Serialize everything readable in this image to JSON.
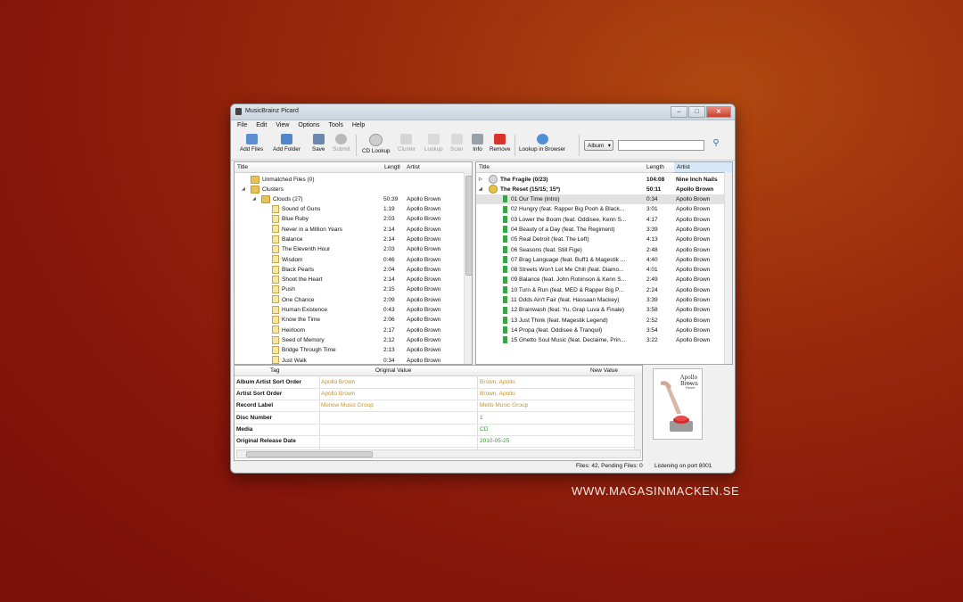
{
  "window": {
    "title": "MusicBrainz Picard"
  },
  "menu": [
    "File",
    "Edit",
    "View",
    "Options",
    "Tools",
    "Help"
  ],
  "toolbar": {
    "add_files": "Add Files",
    "add_folder": "Add Folder",
    "save": "Save",
    "submit": "Submit",
    "cd_lookup": "CD Lookup",
    "cluster": "Cluster",
    "lookup": "Lookup",
    "scan": "Scan",
    "info": "Info",
    "remove": "Remove",
    "lookup_browser": "Lookup in Browser",
    "album_select": "Album"
  },
  "left_panel": {
    "headers": {
      "title": "Title",
      "length": "Lengtl",
      "artist": "Artist"
    },
    "unmatched": "Unmatched Files (0)",
    "clusters": "Clusters",
    "cluster": {
      "title": "Clouds (27)",
      "length": "50:39",
      "artist": "Apollo Brown"
    },
    "files": [
      {
        "title": "Sound of Guns",
        "length": "1:19",
        "artist": "Apollo Brown"
      },
      {
        "title": "Blue Ruby",
        "length": "2:03",
        "artist": "Apollo Brown"
      },
      {
        "title": "Never in a Million Years",
        "length": "2:14",
        "artist": "Apollo Brown"
      },
      {
        "title": "Balance",
        "length": "2:14",
        "artist": "Apollo Brown"
      },
      {
        "title": "The Eleventh Hour",
        "length": "2:03",
        "artist": "Apollo Brown"
      },
      {
        "title": "Wisdom",
        "length": "0:46",
        "artist": "Apollo Brown"
      },
      {
        "title": "Black Pearls",
        "length": "2:04",
        "artist": "Apollo Brown"
      },
      {
        "title": "Shoot the Heart",
        "length": "2:14",
        "artist": "Apollo Brown"
      },
      {
        "title": "Push",
        "length": "2:15",
        "artist": "Apollo Brown"
      },
      {
        "title": "One Chance",
        "length": "2:09",
        "artist": "Apollo Brown"
      },
      {
        "title": "Human Existence",
        "length": "0:43",
        "artist": "Apollo Brown"
      },
      {
        "title": "Know the Time",
        "length": "2:06",
        "artist": "Apollo Brown"
      },
      {
        "title": "Heirloom",
        "length": "2:17",
        "artist": "Apollo Brown"
      },
      {
        "title": "Seed of Memory",
        "length": "2:12",
        "artist": "Apollo Brown"
      },
      {
        "title": "Bridge Through Time",
        "length": "2:13",
        "artist": "Apollo Brown"
      },
      {
        "title": "Just Walk",
        "length": "0:34",
        "artist": "Apollo Brown"
      }
    ]
  },
  "right_panel": {
    "headers": {
      "title": "Title",
      "length": "Length",
      "artist": "Artist"
    },
    "albums": [
      {
        "title": "The Fragile (0/23)",
        "length": "104:08",
        "artist": "Nine Inch Nails"
      },
      {
        "title": "The Reset (15/15; 15*)",
        "length": "50:11",
        "artist": "Apollo Brown"
      }
    ],
    "tracks": [
      {
        "title": "01  Our Time (intro)",
        "length": "0:34",
        "artist": "Apollo Brown"
      },
      {
        "title": "02  Hungry (feat. Rapper Big Pooh & Black...",
        "length": "3:01",
        "artist": "Apollo Brown"
      },
      {
        "title": "03  Lower the Boom (feat. Oddisee, Kenn S...",
        "length": "4:17",
        "artist": "Apollo Brown"
      },
      {
        "title": "04  Beauty of a Day (feat. The Regiment)",
        "length": "3:39",
        "artist": "Apollo Brown"
      },
      {
        "title": "05  Real Detroit (feat. The Left)",
        "length": "4:13",
        "artist": "Apollo Brown"
      },
      {
        "title": "06  Seasons (feat. Still Fige)",
        "length": "2:48",
        "artist": "Apollo Brown"
      },
      {
        "title": "07  Brag Language (feat. Buff1 & Magestik ...",
        "length": "4:40",
        "artist": "Apollo Brown"
      },
      {
        "title": "08  Streets Won't Let Me Chill (feat. Diamo...",
        "length": "4:01",
        "artist": "Apollo Brown"
      },
      {
        "title": "09  Balance (feat. John Robinson & Kenn S...",
        "length": "2:49",
        "artist": "Apollo Brown"
      },
      {
        "title": "10  Turn & Run (feat. MED & Rapper Big P...",
        "length": "2:24",
        "artist": "Apollo Brown"
      },
      {
        "title": "11  Odds Ain't Fair (feat. Hassaan Mackey)",
        "length": "3:39",
        "artist": "Apollo Brown"
      },
      {
        "title": "12  Brainwash (feat. Yu, Grap Luva & Finale)",
        "length": "3:58",
        "artist": "Apollo Brown"
      },
      {
        "title": "13  Just Think (feat. Magestik Legend)",
        "length": "2:52",
        "artist": "Apollo Brown"
      },
      {
        "title": "14  Propa (feat. Oddisee & Tranquil)",
        "length": "3:54",
        "artist": "Apollo Brown"
      },
      {
        "title": "15  Ghetto Soul Music (feat. Declaime, Prin...",
        "length": "3:22",
        "artist": "Apollo Brown"
      }
    ]
  },
  "metadata": {
    "headers": {
      "tag": "Tag",
      "original": "Original Value",
      "new": "New Value"
    },
    "rows": [
      {
        "tag": "Album Artist Sort Order",
        "original": "Apollo Brown",
        "new": "Brown, Apollo"
      },
      {
        "tag": "Artist Sort Order",
        "original": "Apollo Brown",
        "new": "Brown, Apollo"
      },
      {
        "tag": "Record Label",
        "original": "Mellow Music Group",
        "new": "Mello Music Group"
      },
      {
        "tag": "Disc Number",
        "original": "",
        "new": "1"
      },
      {
        "tag": "Media",
        "original": "",
        "new": "CD"
      },
      {
        "tag": "Original Release Date",
        "original": "",
        "new": "2010-05-25"
      }
    ]
  },
  "cover": {
    "text_line1": "Apollo Brown",
    "text_line2": "The Reset"
  },
  "status": {
    "files": "Files: 42, Pending Files: 0",
    "listening": "Listening on port 8001"
  },
  "watermark": "WWW.MAGASINMACKEN.SE"
}
